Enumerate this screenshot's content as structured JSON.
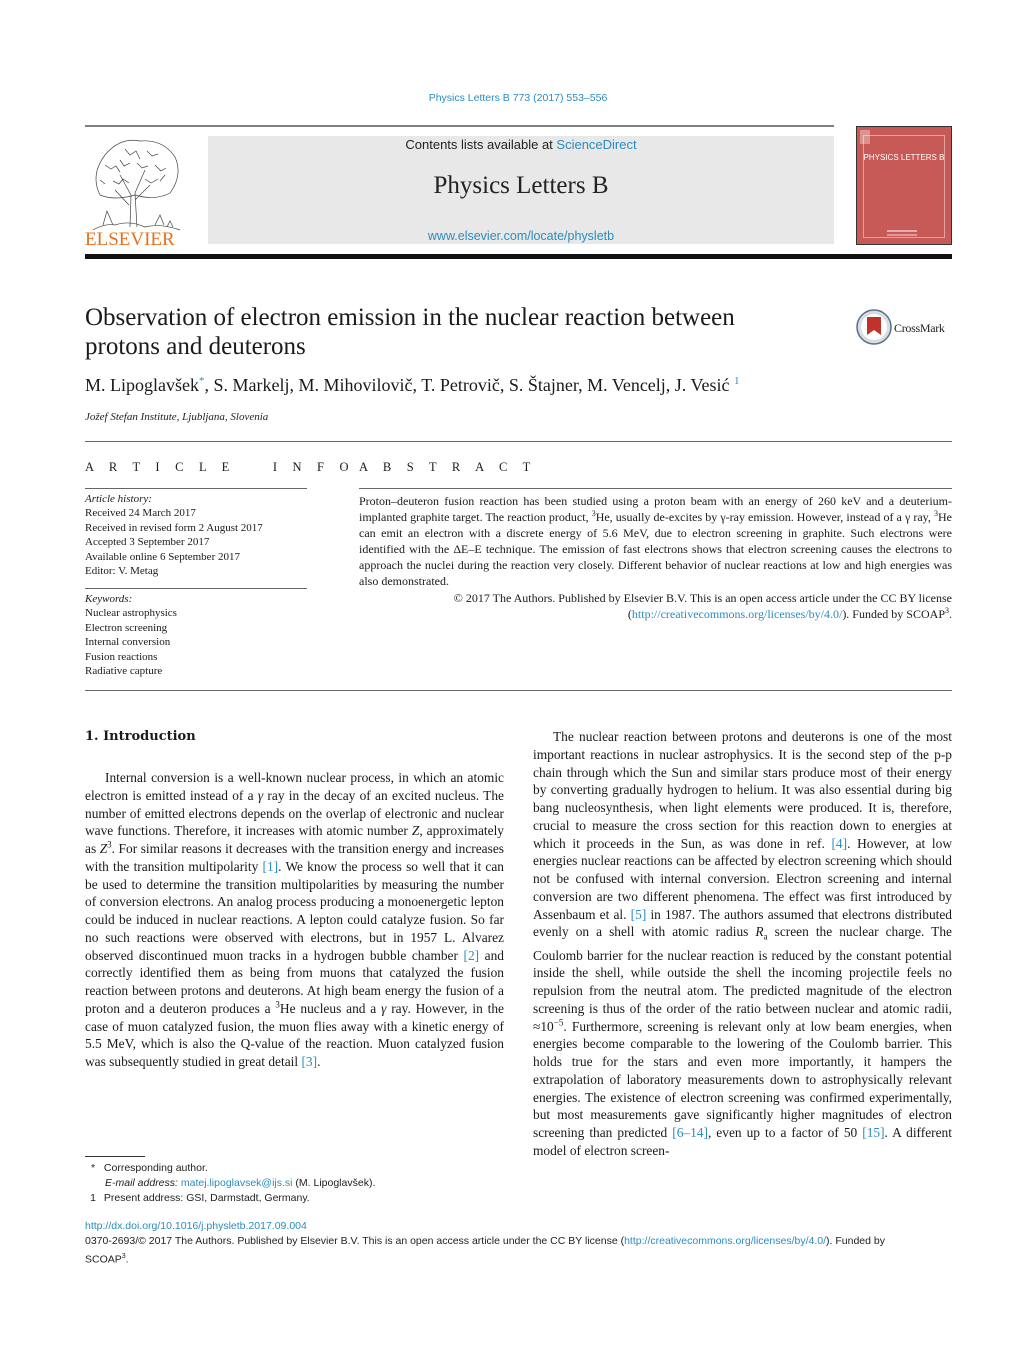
{
  "journal_ref": "Physics Letters B 773 (2017) 553–556",
  "masthead": {
    "contents_prefix": "Contents lists available at ",
    "contents_link": "ScienceDirect",
    "journal_title": "Physics Letters B",
    "journal_url": "www.elsevier.com/locate/physletb",
    "publisher": "ELSEVIER",
    "cover_title": "PHYSICS LETTERS B"
  },
  "article": {
    "title_line1": "Observation of electron emission in the nuclear reaction between",
    "title_line2": "protons and deuterons",
    "crossmark": "CrossMark",
    "authors": [
      {
        "name": "M. Lipoglavšek",
        "mark": "*"
      },
      {
        "name": "S. Markelj"
      },
      {
        "name": "M. Mihovilovič"
      },
      {
        "name": "T. Petrovič"
      },
      {
        "name": "S. Štajner"
      },
      {
        "name": "M. Vencelj"
      },
      {
        "name": "J. Vesić",
        "mark": "1"
      }
    ],
    "affiliation": "Jožef Stefan Institute, Ljubljana, Slovenia"
  },
  "info": {
    "heading": "ARTICLE INFO",
    "history_label": "Article history:",
    "history": [
      "Received 24 March 2017",
      "Received in revised form 2 August 2017",
      "Accepted 3 September 2017",
      "Available online 6 September 2017",
      "Editor: V. Metag"
    ],
    "keywords_label": "Keywords:",
    "keywords": [
      "Nuclear astrophysics",
      "Electron screening",
      "Internal conversion",
      "Fusion reactions",
      "Radiative capture"
    ]
  },
  "abstract": {
    "heading": "ABSTRACT",
    "p1": "Proton–deuteron fusion reaction has been studied using a proton beam with an energy of 260 keV and a deuterium-implanted graphite target. The reaction product, ",
    "sup_3a": "3",
    "p2": "He, usually de-excites by γ-ray emission. However, instead of a γ ray, ",
    "sup_3b": "3",
    "p3": "He can emit an electron with a discrete energy of 5.6 MeV, due to electron screening in graphite. Such electrons were identified with the ΔE–E technique. The emission of fast electrons shows that electron screening causes the electrons to approach the nuclei during the reaction very closely. Different behavior of nuclear reactions at low and high energies was also demonstrated.",
    "copyright": "© 2017 The Authors. Published by Elsevier B.V. This is an open access article under the CC BY license",
    "license_open": "(",
    "license_url": "http://creativecommons.org/licenses/by/4.0/",
    "license_close": "). Funded by SCOAP",
    "scoap_sup": "3",
    "end": "."
  },
  "intro": {
    "heading": "1.  Introduction",
    "left": {
      "a": "Internal conversion is a well-known nuclear process, in which an atomic electron is emitted instead of a ",
      "gamma1": "γ",
      "b": " ray in the decay of an excited nucleus. The number of emitted electrons depends on the overlap of electronic and nuclear wave functions. Therefore, it increases with atomic number ",
      "Z1": "Z",
      "c": ", approximately as ",
      "Z2": "Z",
      "Z2sup": "3",
      "d": ". For similar reasons it decreases with the transition energy and increases with the transition multipolarity ",
      "ref1": "[1]",
      "e": ". We know the process so well that it can be used to determine the transition multipolarities by measuring the number of conversion electrons. An analog process producing a monoenergetic lepton could be induced in nuclear reactions. A lepton could catalyze fusion. So far no such reactions were observed with electrons, but in 1957 L. Alvarez observed discontinued muon tracks in a hydrogen bubble chamber ",
      "ref2": "[2]",
      "f": " and correctly identified them as being from muons that catalyzed the fusion reaction between protons and deuterons. At high beam energy the fusion of a proton and a deuteron produces a ",
      "He_sup": "3",
      "g": "He nucleus and a ",
      "gamma2": "γ",
      "h": " ray. However, in the case of muon catalyzed fusion, the muon flies away with a kinetic energy of 5.5 MeV, which is also the Q-value of the reaction. Muon catalyzed fusion was subsequently studied in great detail ",
      "ref3": "[3]",
      "i": "."
    },
    "right": {
      "a": "The nuclear reaction between protons and deuterons is one of the most important reactions in nuclear astrophysics. It is the second step of the p-p chain through which the Sun and similar stars produce most of their energy by converting gradually hydrogen to helium. It was also essential during big bang nucleosynthesis, when light elements were produced. It is, therefore, crucial to measure the cross section for this reaction down to energies at which it proceeds in the Sun, as was done in ref. ",
      "ref4": "[4]",
      "b": ". However, at low energies nuclear reactions can be affected by electron screening which should not be confused with internal conversion. Electron screening and internal conversion are two different phenomena. The effect was first introduced by Assenbaum et al. ",
      "ref5": "[5]",
      "c": " in 1987. The authors assumed that electrons distributed evenly on a shell with atomic radius ",
      "Ra": "R",
      "Ra_sub": "a",
      "d": " screen the nuclear charge. The Coulomb barrier for the nuclear reaction is reduced by the constant potential inside the shell, while outside the shell the incoming projectile feels no repulsion from the neutral atom. The predicted magnitude of the electron screening is thus of the order of the ratio between nuclear and atomic radii, ≈10",
      "exp": "−5",
      "e": ". Furthermore, screening is relevant only at low beam energies, when energies become comparable to the lowering of the Coulomb barrier. This holds true for the stars and even more importantly, it hampers the extrapolation of laboratory measurements down to astrophysically relevant energies. The existence of electron screening was confirmed experimentally, but most measurements gave significantly higher magnitudes of electron screening than predicted ",
      "ref6": "[6–14]",
      "f": ", even up to a factor of 50 ",
      "ref15": "[15]",
      "g": ". A different model of electron screen-"
    }
  },
  "footnotes": {
    "star_mark": "*",
    "corresponding": "Corresponding author.",
    "email_label": "E-mail address:",
    "email": "matej.lipoglavsek@ijs.si",
    "email_owner": " (M. Lipoglavšek).",
    "one_mark": "1",
    "present_address": "Present address: GSI, Darmstadt, Germany."
  },
  "footer": {
    "doi": "http://dx.doi.org/10.1016/j.physletb.2017.09.004",
    "line2_a": "0370-2693/© 2017 The Authors. Published by Elsevier B.V. This is an open access article under the CC BY license (",
    "line2_url": "http://creativecommons.org/licenses/by/4.0/",
    "line2_b": "). Funded by",
    "line3": "SCOAP",
    "line3_sup": "3",
    "line3_end": "."
  },
  "colors": {
    "link": "#2a8cbf",
    "elsevier_orange": "#e9711c",
    "cover": "#c75a56",
    "masthead_bg": "#e8e8e8"
  }
}
